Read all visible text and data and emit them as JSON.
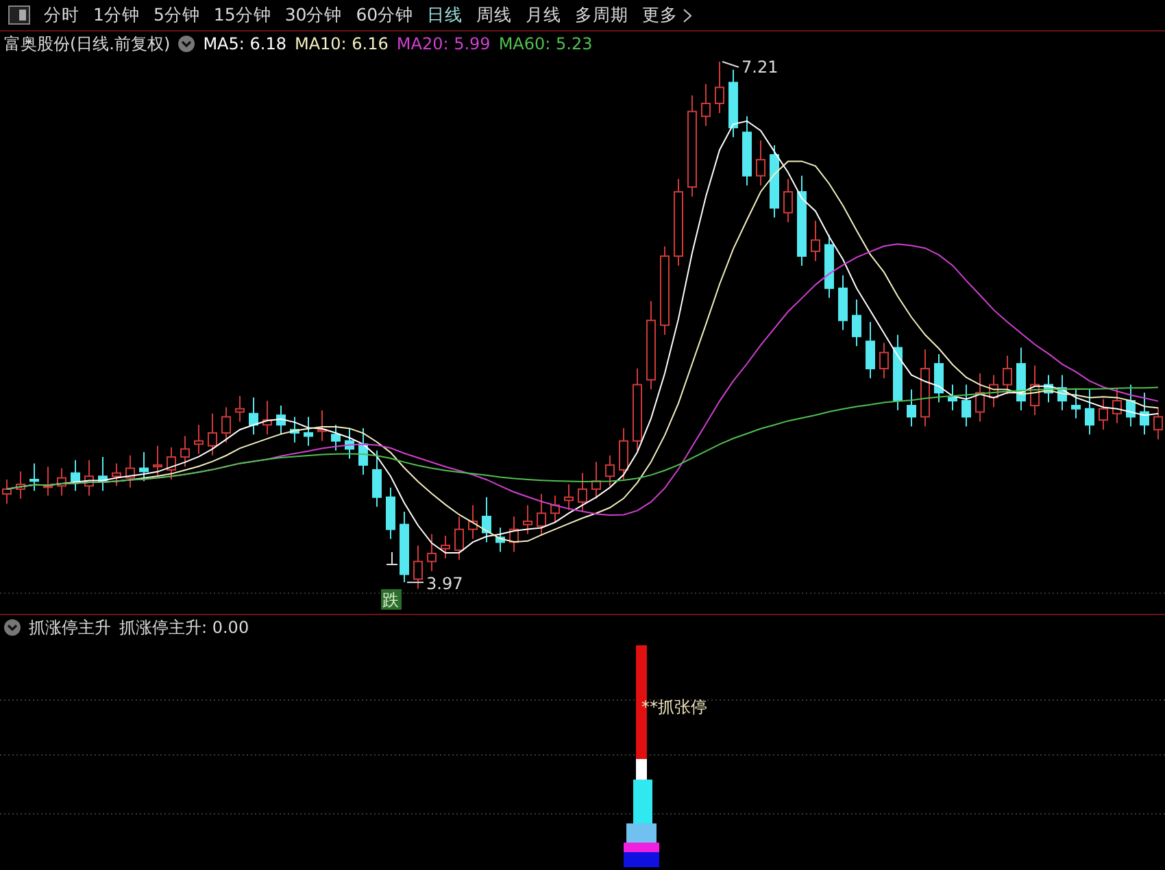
{
  "toolbar": {
    "periods": [
      {
        "label": "分时",
        "selected": false
      },
      {
        "label": "1分钟",
        "selected": false
      },
      {
        "label": "5分钟",
        "selected": false
      },
      {
        "label": "15分钟",
        "selected": false
      },
      {
        "label": "30分钟",
        "selected": false
      },
      {
        "label": "60分钟",
        "selected": false
      },
      {
        "label": "日线",
        "selected": true
      },
      {
        "label": "周线",
        "selected": false
      },
      {
        "label": "月线",
        "selected": false
      },
      {
        "label": "多周期",
        "selected": false
      },
      {
        "label": "更多",
        "selected": false
      }
    ]
  },
  "main_chart": {
    "title": "富奥股份(日线.前复权)",
    "indicators": [
      {
        "label": "MA5: 6.18",
        "color": "#ffffff"
      },
      {
        "label": "MA10: 6.16",
        "color": "#f4f0c0"
      },
      {
        "label": "MA20: 5.99",
        "color": "#d040d0"
      },
      {
        "label": "MA60: 5.23",
        "color": "#50c050"
      }
    ],
    "high_label": "7.21",
    "low_label": "3.97",
    "signal_label": "跌"
  },
  "indicator_panel": {
    "title": "抓涨停主升",
    "value": "抓涨停主升: 0.00",
    "bar_label": "**抓张停"
  }
}
